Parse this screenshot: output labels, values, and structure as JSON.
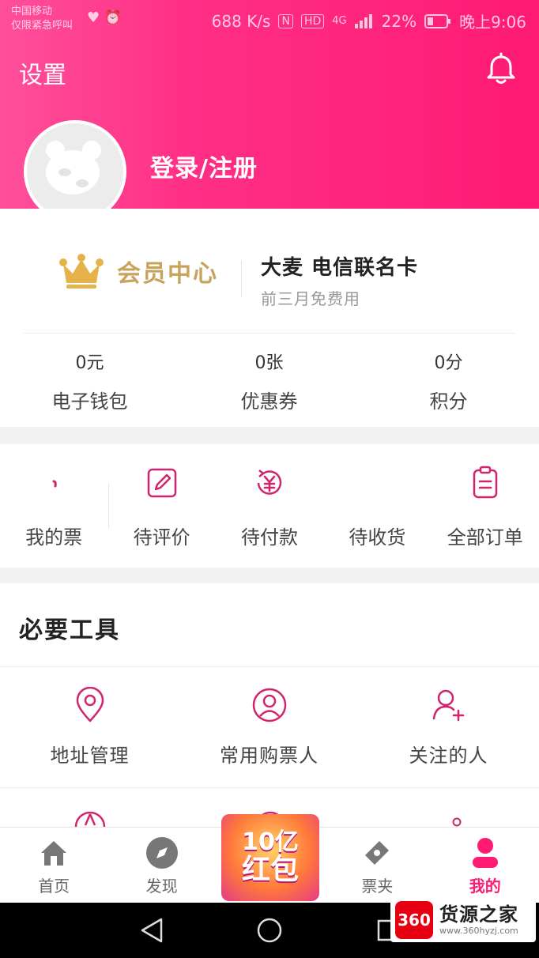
{
  "status_bar": {
    "carrier": "中国移动",
    "emergency": "仅限紧急呼叫",
    "left_icons": "♥ ⏰",
    "speed": "688 K/s",
    "nfc": "N",
    "hd": "HD",
    "network": "4G",
    "battery": "22%",
    "time": "晚上9:06"
  },
  "header": {
    "title": "设置",
    "login": "登录/注册"
  },
  "membership": {
    "vip_label": "会员中心",
    "promo_title": "大麦 电信联名卡",
    "promo_subtitle": "前三月免费用"
  },
  "stats": [
    {
      "value": "0元",
      "label": "电子钱包"
    },
    {
      "value": "0张",
      "label": "优惠券"
    },
    {
      "value": "0分",
      "label": "积分"
    }
  ],
  "orders": [
    {
      "label": "我的票",
      "icon": "ticket-icon"
    },
    {
      "label": "待评价",
      "icon": "edit-icon"
    },
    {
      "label": "待付款",
      "icon": "yuan-icon"
    },
    {
      "label": "待收货",
      "icon": "truck-icon"
    },
    {
      "label": "全部订单",
      "icon": "order-list-icon"
    }
  ],
  "tools": {
    "title": "必要工具",
    "items": [
      {
        "label": "地址管理",
        "icon": "location-icon"
      },
      {
        "label": "常用购票人",
        "icon": "person-icon"
      },
      {
        "label": "关注的人",
        "icon": "add-person-icon"
      }
    ]
  },
  "tabbar": {
    "tabs": [
      {
        "label": "首页",
        "icon": "home-icon"
      },
      {
        "label": "发现",
        "icon": "compass-icon"
      },
      {
        "label": "",
        "icon": "hongbao-icon"
      },
      {
        "label": "票夹",
        "icon": "ticket-holder-icon"
      },
      {
        "label": "我的",
        "icon": "user-icon"
      }
    ],
    "promo_line1": "10亿",
    "promo_line2": "红包"
  },
  "watermark": {
    "badge": "360",
    "title": "货源之家",
    "url": "www.360hyzj.com"
  },
  "colors": {
    "brand": "#ff1a73",
    "gold": "#c7a35c",
    "icon": "#d2236d"
  }
}
